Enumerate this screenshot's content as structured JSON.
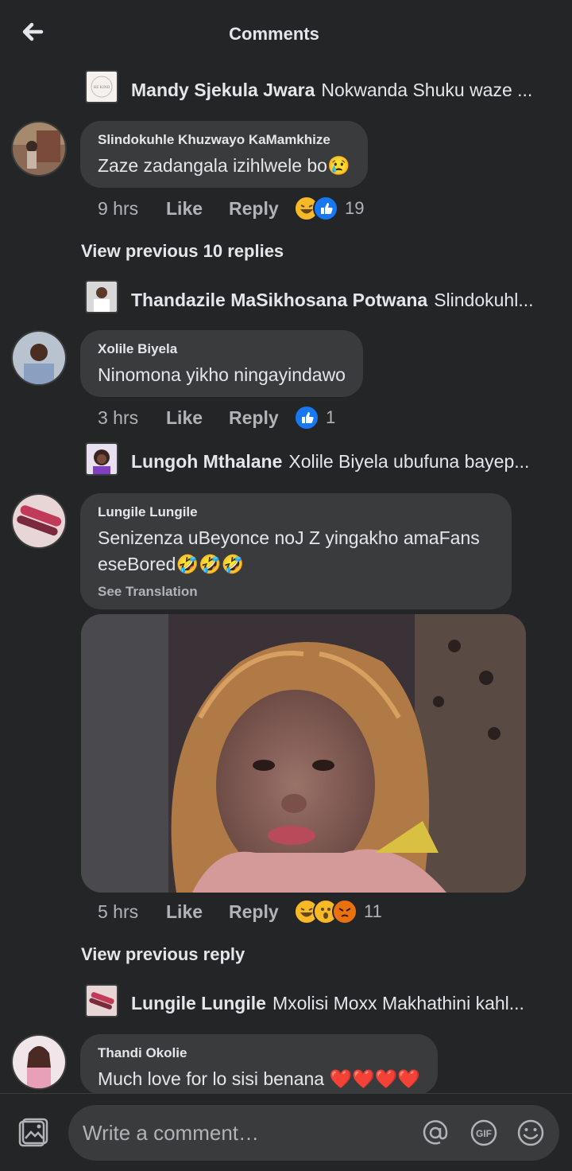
{
  "header": {
    "title": "Comments"
  },
  "threads": [
    {
      "reply_name": "Mandy Sjekula Jwara",
      "reply_text": "Nokwanda Shuku waze ...",
      "reply_avatar_text": "BE KIND"
    },
    {
      "comment_name": "Slindokuhle Khuzwayo KaMamkhize",
      "comment_text": "Zaze zadangala izihlwele bo",
      "comment_emoji": "😢",
      "time": "9 hrs",
      "like": "Like",
      "reply": "Reply",
      "reaction_count": "19"
    },
    {
      "view_previous": "View previous 10 replies"
    },
    {
      "reply_name": "Thandazile MaSikhosana Potwana",
      "reply_text": "Slindokuhl..."
    },
    {
      "comment_name": "Xolile Biyela",
      "comment_text": "Ninomona yikho ningayindawo",
      "time": "3 hrs",
      "like": "Like",
      "reply": "Reply",
      "reaction_count": "1"
    },
    {
      "reply_name": "Lungoh Mthalane",
      "reply_text": "Xolile Biyela ubufuna bayep..."
    },
    {
      "comment_name": "Lungile Lungile",
      "comment_text": "Senizenza uBeyonce noJ Z yingakho  amaFans eseBored🤣🤣🤣",
      "see_translation": "See Translation",
      "time": "5 hrs",
      "like": "Like",
      "reply": "Reply",
      "reaction_count": "11"
    },
    {
      "view_previous": "View previous reply"
    },
    {
      "reply_name": "Lungile Lungile",
      "reply_text": "Mxolisi Moxx Makhathini kahl..."
    },
    {
      "comment_name": "Thandi Okolie",
      "comment_text": "Much love for lo sisi benana ❤️❤️❤️❤️"
    }
  ],
  "composer": {
    "placeholder": "Write a comment…",
    "gif_label": "GIF"
  },
  "colors": {
    "background": "#242526",
    "bubble": "#3a3b3c",
    "muted": "#b0b3b8",
    "like_blue": "#1877f2",
    "haha_yellow": "#f7b928",
    "angry_orange": "#e9710f"
  }
}
